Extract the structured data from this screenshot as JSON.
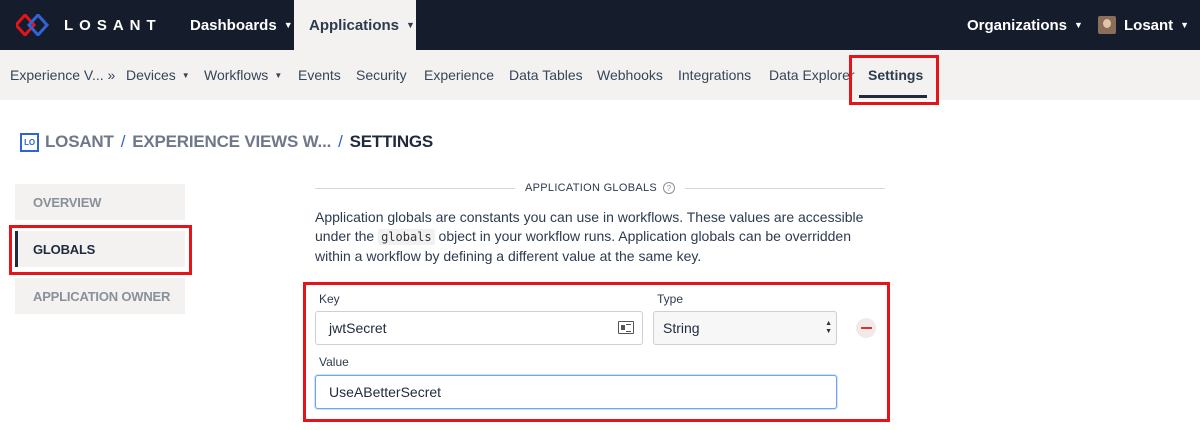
{
  "brand": {
    "name": "LOSANT"
  },
  "topnav": {
    "dashboards": "Dashboards",
    "applications": "Applications",
    "organizations": "Organizations",
    "user": "Losant"
  },
  "subnav": {
    "items": [
      {
        "label": "Experience V... »"
      },
      {
        "label": "Devices"
      },
      {
        "label": "Workflows"
      },
      {
        "label": "Events"
      },
      {
        "label": "Security"
      },
      {
        "label": "Experience"
      },
      {
        "label": "Data Tables"
      },
      {
        "label": "Webhooks"
      },
      {
        "label": "Integrations"
      },
      {
        "label": "Data Explorer"
      },
      {
        "label": "Settings"
      }
    ]
  },
  "breadcrumb": {
    "badge": "LO",
    "app": "LOSANT",
    "sep": "/",
    "view": "EXPERIENCE VIEWS W...",
    "current": "SETTINGS"
  },
  "sidebar": {
    "items": [
      {
        "label": "OVERVIEW"
      },
      {
        "label": "GLOBALS"
      },
      {
        "label": "APPLICATION OWNER"
      }
    ]
  },
  "section": {
    "title": "APPLICATION GLOBALS",
    "help": "?",
    "desc_part1": "Application globals are constants you can use in workflows. These values are accessible under the ",
    "desc_code": "globals",
    "desc_part2": " object in your workflow runs. Application globals can be overridden within a workflow by defining a different value at the same key."
  },
  "global_row": {
    "key_label": "Key",
    "key_value": "jwtSecret",
    "type_label": "Type",
    "type_value": "String",
    "value_label": "Value",
    "value_value": "UseABetterSecret"
  },
  "colors": {
    "navbar": "#151d2c",
    "subbar": "#f3f2f0",
    "highlight": "#e5141a",
    "accent": "#3064d4"
  }
}
